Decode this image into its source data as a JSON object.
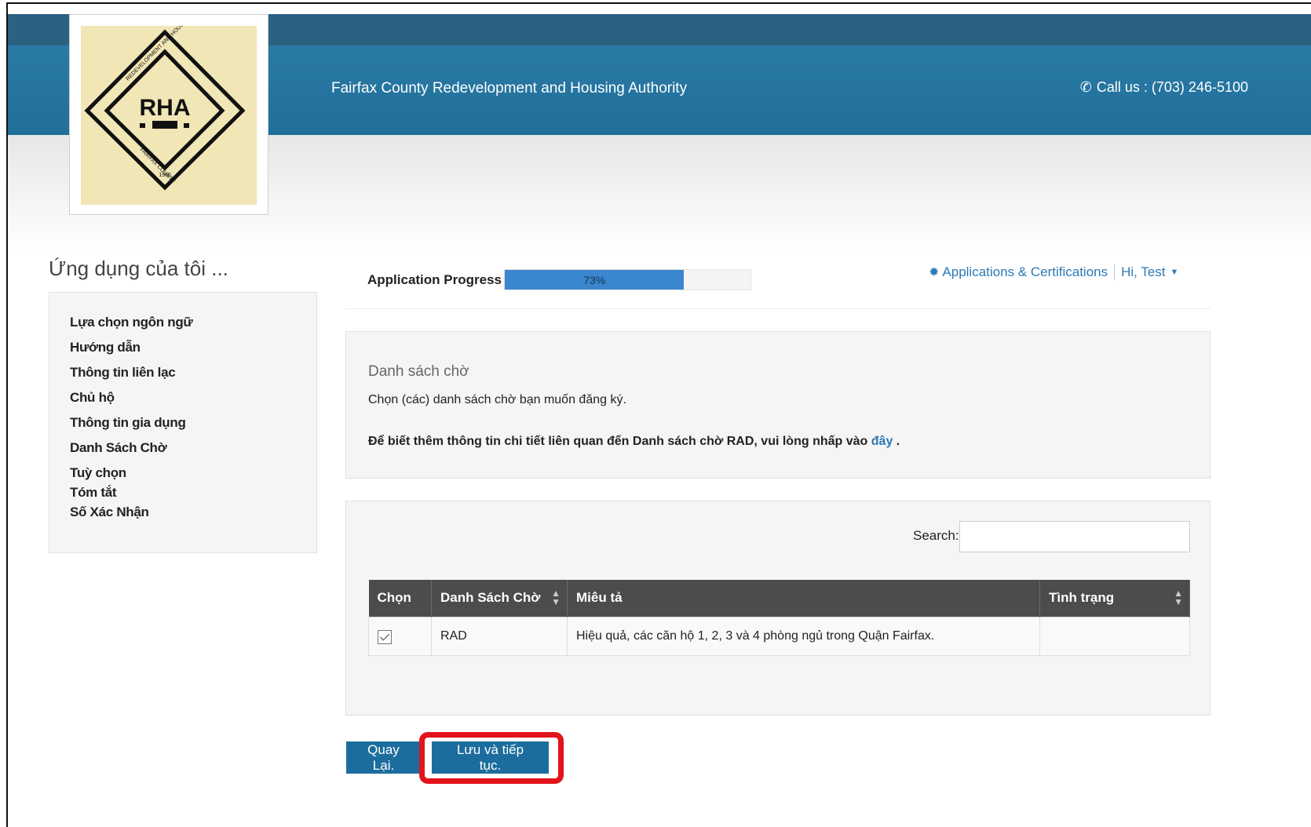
{
  "header": {
    "logo_text": "RHA",
    "logo_ring_top": "REDEVELOPMENT AND HOUSING AUTHORITY",
    "logo_ring_bottom": "FAIRFAX COUNTY",
    "logo_year": "1966",
    "site_title": "Fairfax County Redevelopment and Housing Authority",
    "call_label": "Call us : (703) 246-5100",
    "phone_icon": "phone-icon"
  },
  "sidebar": {
    "title": "Ứng dụng của tôi ...",
    "items": [
      "Lựa chọn ngôn ngữ",
      "Hướng dẫn",
      "Thông tin liên lạc",
      "Chủ hộ",
      "Thông tin gia dụng",
      "Danh Sách Chờ",
      "Tuỳ chọn",
      "Tóm tắt",
      "Số Xác Nhận"
    ]
  },
  "progress": {
    "label": "Application Progress",
    "percent": 73,
    "percent_text": "73%"
  },
  "top_links": {
    "applications": "Applications & Certifications",
    "user": "Hi, Test"
  },
  "waitlist_panel": {
    "title": "Danh sách chờ",
    "subtitle": "Chọn (các) danh sách chờ bạn muốn đăng ký.",
    "info_text": "Để biết thêm thông tin chi tiết liên quan đến Danh sách chờ RAD, vui lòng nhấp vào",
    "info_link": "đây",
    "info_end": "."
  },
  "table": {
    "search_label": "Search:",
    "search_value": "",
    "columns": [
      "Chọn",
      "Danh Sách Chờ",
      "Miêu tả",
      "Tình trạng"
    ],
    "rows": [
      {
        "checked": true,
        "waitlist": "RAD",
        "description": "Hiệu quả, các căn hộ 1, 2, 3 và 4 phòng ngủ trong Quận Fairfax.",
        "status": ""
      }
    ]
  },
  "buttons": {
    "back": "Quay Lại.",
    "save": "Lưu và tiếp tục."
  },
  "colors": {
    "header_dark": "#2b6282",
    "header_band": "#1f6f99",
    "progress_fill": "#3a86cf",
    "link": "#2c79b5",
    "button": "#1c6d9d",
    "highlight": "#e3131a"
  }
}
